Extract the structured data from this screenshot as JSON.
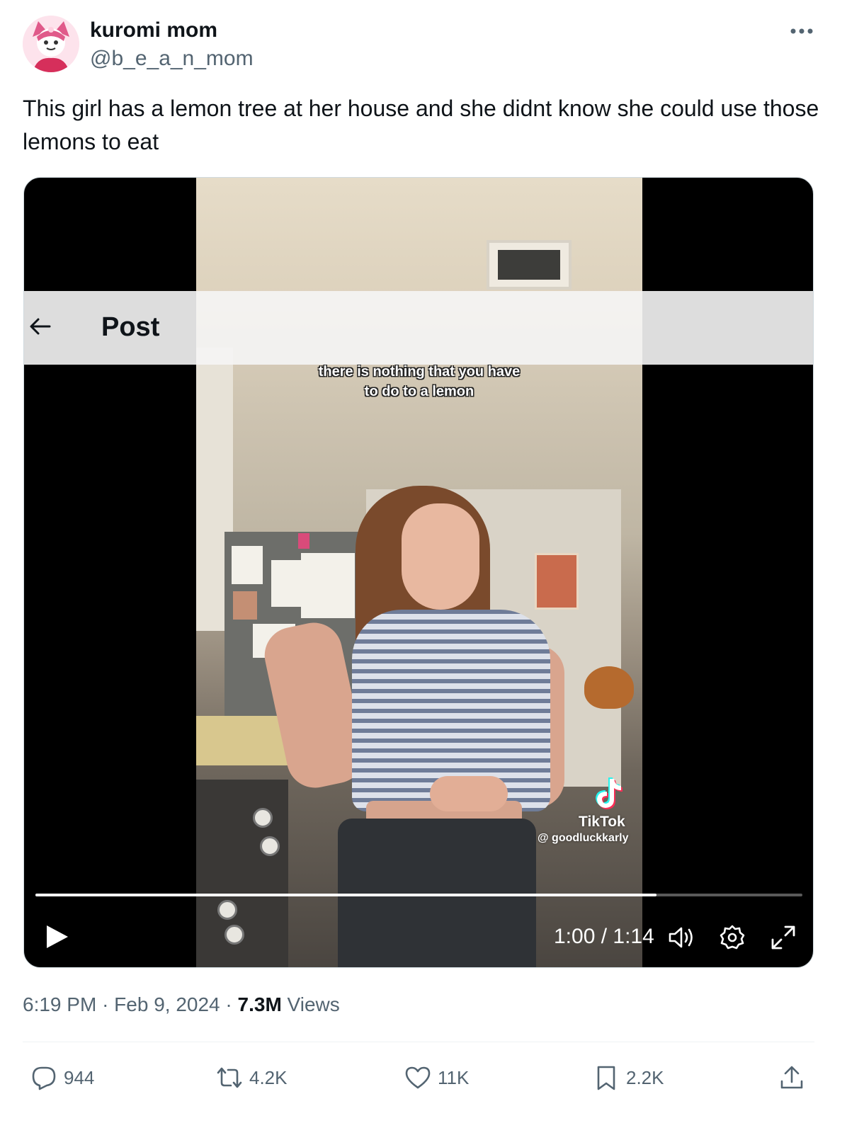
{
  "tweet": {
    "author": {
      "display_name": "kuromi mom",
      "handle": "@b_e_a_n_mom",
      "avatar_icon": "kuromi-avatar"
    },
    "text": "This girl has a lemon tree at her house and she didnt know she could use those lemons to eat",
    "timestamp": {
      "time": "6:19 PM",
      "separator": "·",
      "date": "Feb 9, 2024",
      "views_count": "7.3M",
      "views_label": "Views"
    },
    "actions": {
      "replies": "944",
      "reposts": "4.2K",
      "likes": "11K",
      "bookmarks": "2.2K"
    }
  },
  "video": {
    "caption_line1": "there is nothing that you have",
    "caption_line2": "to do to a lemon",
    "watermark_brand": "TikTok",
    "watermark_user": "@ goodluckkarly",
    "time_display": "1:00 / 1:14",
    "progress_fraction": 0.81,
    "controls": [
      "play-icon",
      "volume-icon",
      "settings-icon",
      "fullscreen-icon"
    ]
  },
  "overlay_header": {
    "title": "Post",
    "back_icon": "arrow-left-icon"
  },
  "colors": {
    "text_primary": "#0f1419",
    "text_secondary": "#536471",
    "divider": "#eff3f4"
  }
}
